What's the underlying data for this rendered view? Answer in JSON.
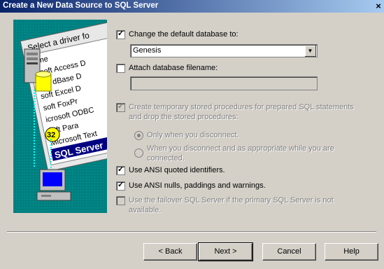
{
  "window": {
    "title": "Create a New Data Source to SQL Server",
    "close_glyph": "×"
  },
  "illustration": {
    "header": "Select a driver fo",
    "items": [
      "ame",
      "osoft Access D",
      "soft dBase D",
      "soft Excel D",
      "soft FoxPr",
      "icrosoft ODBC",
      "soft Para",
      "Microsoft Text",
      "SQL Server"
    ],
    "badge": "32"
  },
  "options": {
    "change_default_db": {
      "label": "Change the default database to:",
      "checked": true
    },
    "default_db_value": "Genesis",
    "attach_filename": {
      "label": "Attach database filename:",
      "checked": false
    },
    "attach_filename_value": "",
    "temp_procs": {
      "label_line1": "Create temporary stored procedures for prepared SQL statements",
      "label_line2": "and drop the stored procedures:",
      "checked": true,
      "enabled": false
    },
    "radio_disconnect": {
      "label": "Only when you disconnect.",
      "selected": true,
      "enabled": false
    },
    "radio_appropriate": {
      "label_line1": "When you disconnect and as appropriate while you are",
      "label_line2": "connected.",
      "selected": false,
      "enabled": false
    },
    "ansi_quoted": {
      "label": "Use ANSI quoted identifiers.",
      "checked": true
    },
    "ansi_nulls": {
      "label": "Use ANSI nulls, paddings and warnings.",
      "checked": true
    },
    "failover": {
      "label_line1": "Use the failover SQL Server if the primary SQL Server is not",
      "label_line2": "available.",
      "checked": false,
      "enabled": false
    }
  },
  "buttons": {
    "back": "< Back",
    "next": "Next >",
    "cancel": "Cancel",
    "help": "Help"
  }
}
